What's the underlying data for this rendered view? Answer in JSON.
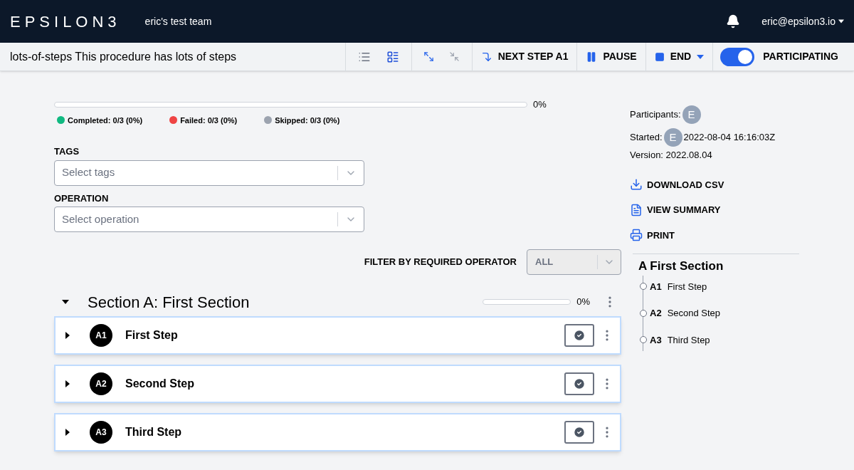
{
  "header": {
    "logo": "EPSILON3",
    "team": "eric's test team",
    "user": "eric@epsilon3.io"
  },
  "toolbar": {
    "title": "lots-of-steps This procedure has lots of steps",
    "views": [
      {
        "kind": "list",
        "selected": false
      },
      {
        "kind": "detail",
        "selected": true
      }
    ],
    "next_step": "NEXT STEP A1",
    "pause": "PAUSE",
    "end": "END",
    "participating": {
      "label": "PARTICIPATING",
      "on": true
    }
  },
  "progress": {
    "level": 0,
    "reading": "0%",
    "legend": [
      {
        "label": "Completed: 0/3 (0%)",
        "color": "#10b981"
      },
      {
        "label": "Failed: 0/3 (0%)",
        "color": "#ef4444"
      },
      {
        "label": "Skipped: 0/3 (0%)",
        "color": "#9ca3af"
      }
    ]
  },
  "filters": [
    {
      "label": "TAGS",
      "placeholder": "Select tags"
    },
    {
      "label": "OPERATION",
      "placeholder": "Select operation"
    }
  ],
  "operator_filter": {
    "label": "FILTER BY REQUIRED OPERATOR",
    "value": "ALL"
  },
  "section": {
    "title": "Section A: First Section",
    "expanded": true,
    "level": 0,
    "reading": "0%",
    "steps": [
      {
        "id": "A1",
        "title": "First Step"
      },
      {
        "id": "A2",
        "title": "Second Step"
      },
      {
        "id": "A3",
        "title": "Third Step"
      }
    ]
  },
  "sidebar": {
    "participants_label": "Participants:",
    "participant_avatar": "E",
    "started_label": "Started:",
    "started_avatar": "E",
    "started": "2022-08-04 16:16:03Z",
    "version": "Version: 2022.08.04",
    "actions": [
      {
        "kind": "download",
        "label": "DOWNLOAD CSV"
      },
      {
        "kind": "summary",
        "label": "VIEW SUMMARY"
      },
      {
        "kind": "print",
        "label": "PRINT"
      }
    ],
    "outline_title": "A First Section",
    "outline": [
      {
        "id": "A1",
        "title": "First Step"
      },
      {
        "id": "A2",
        "title": "Second Step"
      },
      {
        "id": "A3",
        "title": "Third Step"
      }
    ]
  }
}
